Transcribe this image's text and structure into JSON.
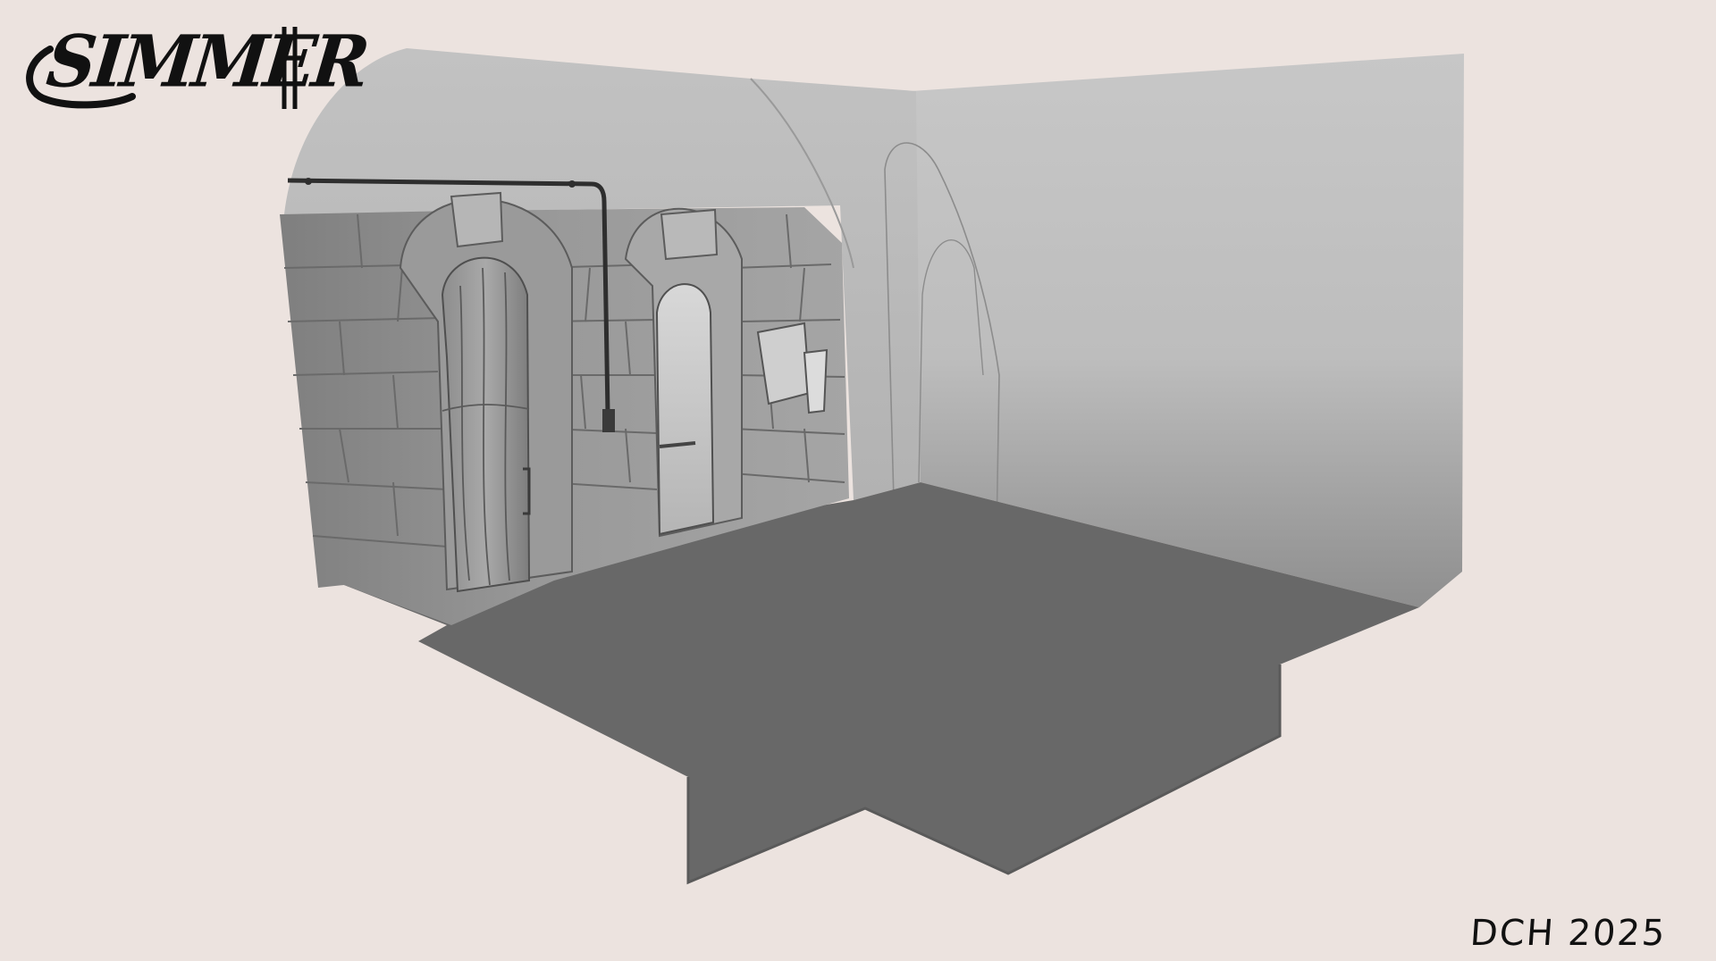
{
  "logo": {
    "text": "SIMMER"
  },
  "signature": {
    "text": "DCH 2025"
  },
  "palette": {
    "background": "#ece3df",
    "floor": "#686868",
    "wall_light": "#cfcfcf",
    "wall_mid": "#a8a8a8",
    "stone": "#8c8c8c",
    "ink": "#111111"
  },
  "icons": [
    "fork-icon",
    "pipe",
    "wooden-door",
    "stone-archway",
    "posted-notice"
  ]
}
